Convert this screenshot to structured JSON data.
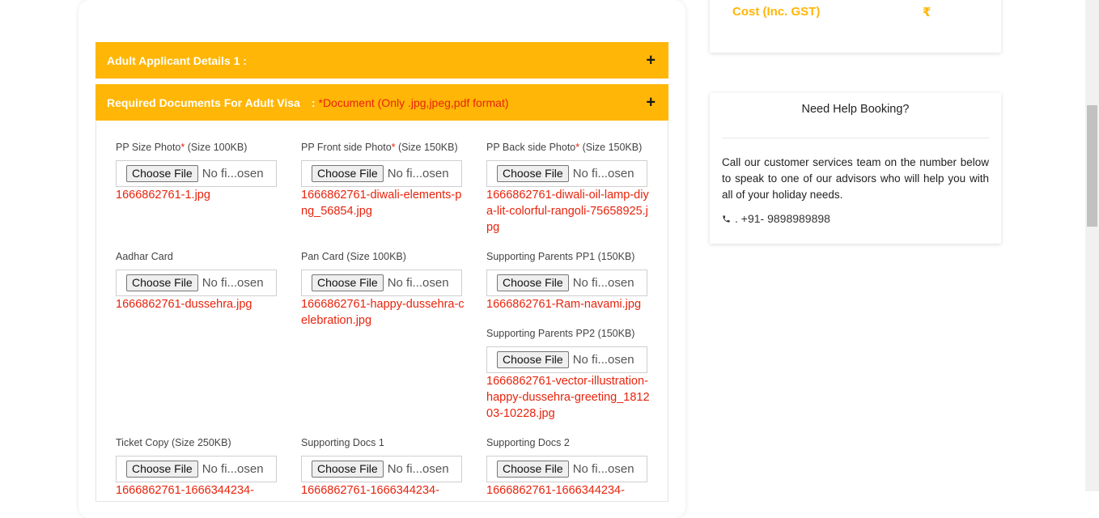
{
  "accordion": {
    "adult_applicant": "Adult Applicant Details 1 :",
    "required_docs": "Required Documents For Adult Visa",
    "required_docs_colon": ":",
    "required_docs_note": "*Document (Only .jpg,jpeg,pdf format)",
    "toggle": "+"
  },
  "file_button_label": "Choose File",
  "file_status": "No fi...osen",
  "fields": [
    {
      "label": "PP Size Photo",
      "required": "*",
      "size": " (Size 100KB)",
      "file": "1666862761-1.jpg"
    },
    {
      "label": "PP Front side Photo",
      "required": "*",
      "size": " (Size 150KB)",
      "file": "1666862761-diwali-elements-png_56854.jpg"
    },
    {
      "label": "PP Back side Photo",
      "required": "*",
      "size": " (Size 150KB)",
      "file": "1666862761-diwali-oil-lamp-diya-lit-colorful-rangoli-75658925.jpg"
    },
    {
      "label": "Aadhar Card",
      "required": "",
      "size": "",
      "file": "1666862761-dussehra.jpg"
    },
    {
      "label": "Pan Card (Size 100KB)",
      "required": "",
      "size": "",
      "file": "1666862761-happy-dussehra-celebration.jpg"
    },
    {
      "label": "Supporting Parents PP1 (150KB)",
      "required": "",
      "size": "",
      "file": "1666862761-Ram-navami.jpg"
    },
    {
      "label": "Supporting Parents PP2 (150KB)",
      "required": "",
      "size": "",
      "file": "1666862761-vector-illustration-happy-dussehra-greeting_181203-10228.jpg"
    },
    {
      "label": "Ticket Copy (Size 250KB)",
      "required": "",
      "size": "",
      "file": "1666862761-1666344234-"
    },
    {
      "label": "Supporting Docs 1",
      "required": "",
      "size": "",
      "file": "1666862761-1666344234-"
    },
    {
      "label": "Supporting Docs 2",
      "required": "",
      "size": "",
      "file": "1666862761-1666344234-"
    }
  ],
  "cost": {
    "label": "Cost (Inc. GST)",
    "value": "₹"
  },
  "help": {
    "title": "Need Help Booking?",
    "text": "Call our customer services team on the number below to speak to one of our advisors who will help you with all of your holiday needs.",
    "phone": ". +91- 9898989898"
  },
  "colors": {
    "accent": "#ffb606",
    "error_red": "#e8230c"
  },
  "icons": {
    "toggle": "plus-icon",
    "phone": "phone-icon"
  }
}
